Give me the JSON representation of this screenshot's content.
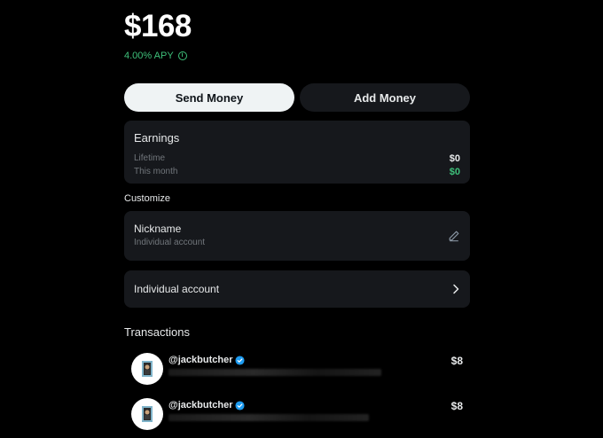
{
  "balance": "$168",
  "apy": "4.00% APY",
  "buttons": {
    "send": "Send Money",
    "add": "Add Money"
  },
  "earnings": {
    "title": "Earnings",
    "rows": [
      {
        "label": "Lifetime",
        "value": "$0"
      },
      {
        "label": "This month",
        "value": "$0"
      }
    ]
  },
  "customize": {
    "heading": "Customize",
    "nickname_title": "Nickname",
    "nickname_sub": "Individual account",
    "account_type": "Individual account"
  },
  "transactions": {
    "heading": "Transactions",
    "items": [
      {
        "handle": "@jackbutcher",
        "amount": "$8"
      },
      {
        "handle": "@jackbutcher",
        "amount": "$8"
      }
    ]
  },
  "colors": {
    "accent_green": "#3ec07a",
    "verified_blue": "#1d9bf0"
  },
  "icons": [
    "info-icon",
    "pencil-icon",
    "chevron-right-icon",
    "verified-badge-icon"
  ]
}
